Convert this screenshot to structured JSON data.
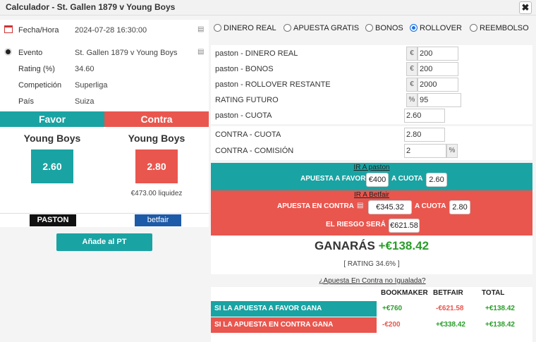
{
  "window": {
    "title": "Calculador - St. Gallen 1879 v Young Boys",
    "close_glyph": "✖"
  },
  "event_info": [
    {
      "label": "Fecha/Hora",
      "value": "2024-07-28 16:30:00",
      "icon": "calendar-icon"
    },
    {
      "label": "Evento",
      "value": "St. Gallen 1879 v Young Boys",
      "icon": "soccer-ball-icon"
    },
    {
      "label": "Rating (%)",
      "value": "34.60"
    },
    {
      "label": "Competición",
      "value": "Superliga"
    },
    {
      "label": "País",
      "value": "Suiza"
    }
  ],
  "favor": {
    "header": "Favor",
    "team": "Young Boys",
    "odds": "2.60",
    "logo": "PASTON",
    "color": "#1aa3a3"
  },
  "contra": {
    "header": "Contra",
    "team": "Young Boys",
    "odds": "2.80",
    "liquidity": "€473.00 liquidez",
    "logo": "betfair",
    "color": "#e9564e"
  },
  "add_pt_label": "Añade al PT",
  "bet_types": [
    {
      "label": "DINERO REAL",
      "selected": false
    },
    {
      "label": "APUESTA GRATIS",
      "selected": false
    },
    {
      "label": "BONOS",
      "selected": false
    },
    {
      "label": "ROLLOVER",
      "selected": true
    },
    {
      "label": "REEMBOLSO",
      "selected": false
    }
  ],
  "fields": {
    "dinero_real": {
      "label": "paston - DINERO REAL",
      "unit": "€",
      "value": "200"
    },
    "bonos": {
      "label": "paston - BONOS",
      "unit": "€",
      "value": "200"
    },
    "rollover": {
      "label": "paston - ROLLOVER RESTANTE",
      "unit": "€",
      "value": "2000"
    },
    "rating_futuro": {
      "label": "RATING FUTURO",
      "unit": "%",
      "value": "95"
    },
    "cuota": {
      "label": "paston - CUOTA",
      "value": "2.60"
    },
    "contra_cuota": {
      "label": "CONTRA - CUOTA",
      "value": "2.80"
    },
    "contra_comision": {
      "label": "CONTRA - COMISIÓN",
      "value": "2",
      "unit": "%"
    }
  },
  "favor_band": {
    "link": "IR A paston",
    "bet_label": "APUESTA A FAVOR",
    "bet_value": "€400",
    "odds_label": "A CUOTA",
    "odds_value": "2.60"
  },
  "contra_band": {
    "link": "IR A Betfair",
    "bet_label": "APUESTA EN CONTRA",
    "bet_value": "€345.32",
    "odds_label": "A CUOTA",
    "odds_value": "2.80",
    "risk_label": "EL RIESGO SERÁ",
    "risk_value": "€621.58"
  },
  "result": {
    "label": "GANARÁS",
    "amount": "+€138.42",
    "rating": "[ RATING 34.6% ]"
  },
  "unmatched_link": "¿Apuesta En Contra no Igualada?",
  "outcome_table": {
    "headers": [
      "BOOKMAKER",
      "BETFAIR",
      "TOTAL"
    ],
    "rows": [
      {
        "label": "SI LA APUESTA A FAVOR GANA",
        "bookmaker": "+€760",
        "betfair": "-€621.58",
        "total": "+€138.42"
      },
      {
        "label": "SI LA APUESTA EN CONTRA GANA",
        "bookmaker": "-€200",
        "betfair": "+€338.42",
        "total": "+€138.42"
      }
    ]
  }
}
